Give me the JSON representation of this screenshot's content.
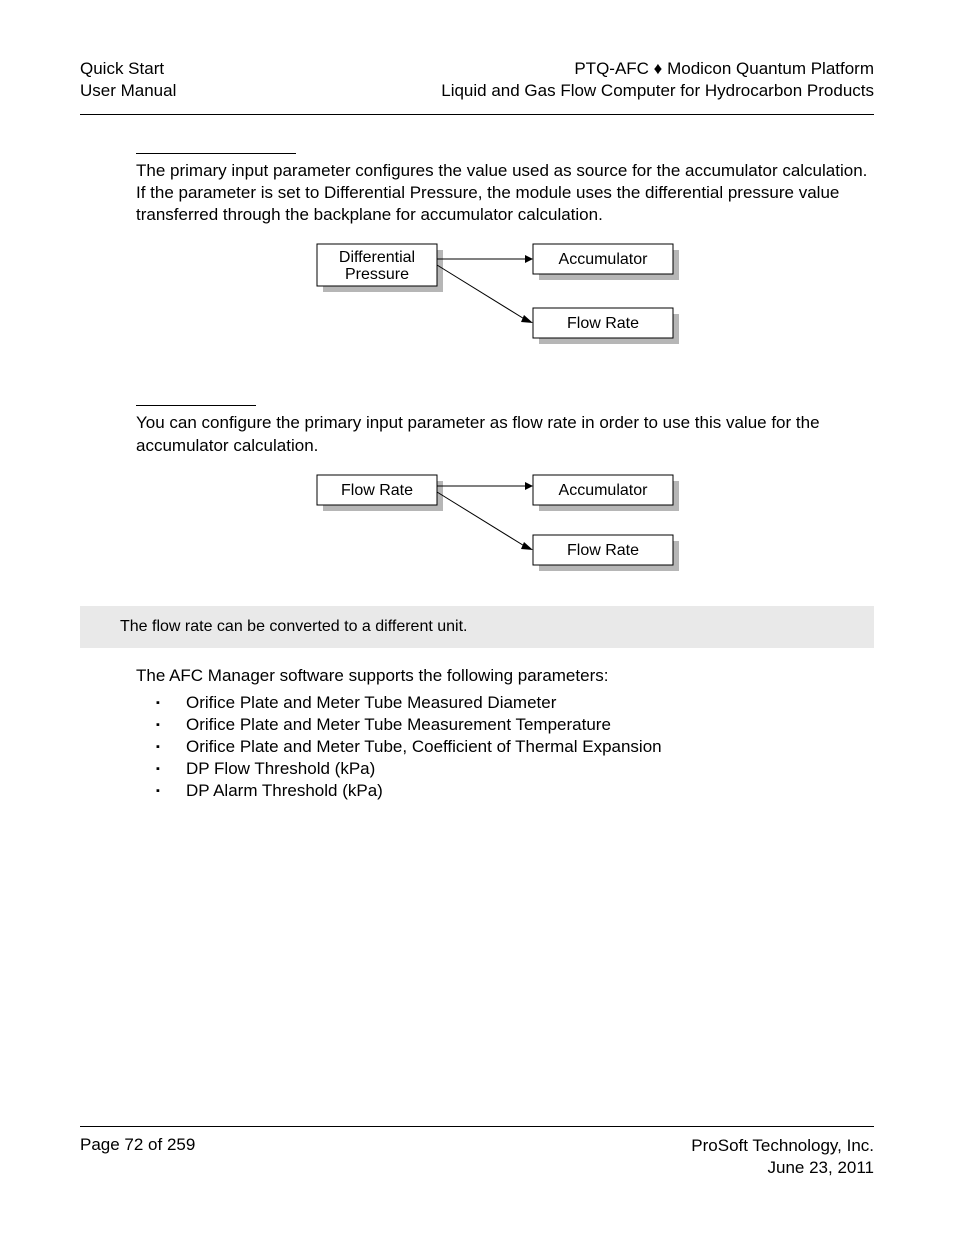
{
  "header": {
    "left_line1": "Quick Start",
    "left_line2": "User Manual",
    "right_line1": "PTQ-AFC ♦ Modicon Quantum Platform",
    "right_line2": "Liquid and Gas Flow Computer for Hydrocarbon Products"
  },
  "section1": {
    "paragraph": "The primary input parameter configures the value used as source for the accumulator calculation. If the parameter is set to Differential Pressure, the module uses the differential pressure value transferred through the backplane for accumulator calculation."
  },
  "diagram1": {
    "left_line1": "Differential",
    "left_line2": "Pressure",
    "right_top": "Accumulator",
    "right_bottom": "Flow Rate"
  },
  "section2": {
    "paragraph": "You can configure the primary input parameter as flow rate in order to use this value for the accumulator calculation."
  },
  "diagram2": {
    "left": "Flow Rate",
    "right_top": "Accumulator",
    "right_bottom": "Flow Rate"
  },
  "note": "The flow rate can be converted to a different unit.",
  "params_intro": "The AFC Manager software supports the following parameters:",
  "params": [
    "Orifice Plate and Meter Tube Measured Diameter",
    "Orifice Plate and Meter Tube Measurement Temperature",
    "Orifice Plate and Meter Tube, Coefficient of Thermal Expansion",
    "DP Flow Threshold (kPa)",
    "DP Alarm Threshold (kPa)"
  ],
  "footer": {
    "page": "Page 72 of 259",
    "company": "ProSoft Technology, Inc.",
    "date": "June 23, 2011"
  }
}
